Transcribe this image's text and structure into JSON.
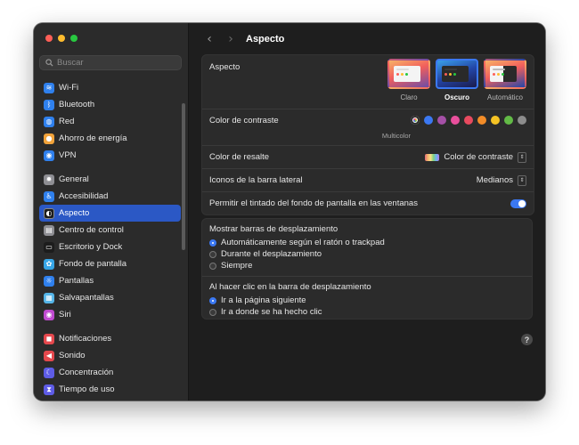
{
  "window": {
    "title": "Aspecto"
  },
  "sidebar": {
    "search_placeholder": "Buscar",
    "groups": [
      [
        {
          "label": "Wi-Fi",
          "icon": "wifi-icon",
          "color": "#2f80ed"
        },
        {
          "label": "Bluetooth",
          "icon": "bluetooth-icon",
          "color": "#2f80ed"
        },
        {
          "label": "Red",
          "icon": "globe-icon",
          "color": "#2f80ed"
        },
        {
          "label": "Ahorro de energía",
          "icon": "lightbulb-icon",
          "color": "#f2a33b"
        },
        {
          "label": "VPN",
          "icon": "vpn-icon",
          "color": "#2f80ed"
        }
      ],
      [
        {
          "label": "General",
          "icon": "gear-icon",
          "color": "#8e8e93"
        },
        {
          "label": "Accesibilidad",
          "icon": "accessibility-icon",
          "color": "#2f80ed"
        },
        {
          "label": "Aspecto",
          "icon": "appearance-icon",
          "color": "#1c1c1c",
          "active": true
        },
        {
          "label": "Centro de control",
          "icon": "control-center-icon",
          "color": "#8e8e93"
        },
        {
          "label": "Escritorio y Dock",
          "icon": "dock-icon",
          "color": "#1c1c1c"
        },
        {
          "label": "Fondo de pantalla",
          "icon": "wallpaper-icon",
          "color": "#37a6e6"
        },
        {
          "label": "Pantallas",
          "icon": "display-icon",
          "color": "#2f80ed"
        },
        {
          "label": "Salvapantallas",
          "icon": "screensaver-icon",
          "color": "#55b5e8"
        },
        {
          "label": "Siri",
          "icon": "siri-icon",
          "color": "#c04ad0"
        }
      ],
      [
        {
          "label": "Notificaciones",
          "icon": "bell-icon",
          "color": "#e5484d"
        },
        {
          "label": "Sonido",
          "icon": "speaker-icon",
          "color": "#e5484d"
        },
        {
          "label": "Concentración",
          "icon": "moon-icon",
          "color": "#5e5ce6"
        },
        {
          "label": "Tiempo de uso",
          "icon": "hourglass-icon",
          "color": "#5e5ce6"
        }
      ]
    ]
  },
  "appearance": {
    "label": "Aspecto",
    "options": [
      {
        "label": "Claro",
        "selected": false
      },
      {
        "label": "Oscuro",
        "selected": true
      },
      {
        "label": "Automático",
        "selected": false
      }
    ]
  },
  "contrast": {
    "label": "Color de contraste",
    "colors": [
      "multicolor",
      "#3b78f2",
      "#a550a7",
      "#e94f9c",
      "#e84a5f",
      "#f28c28",
      "#f5c324",
      "#62ba46",
      "#8c8c8c"
    ],
    "selected_caption": "Multicolor"
  },
  "highlight": {
    "label": "Color de resalte",
    "value": "Color de contraste"
  },
  "sidebar_icons": {
    "label": "Iconos de la barra lateral",
    "value": "Medianos"
  },
  "tinting": {
    "label": "Permitir el tintado del fondo de pantalla en las ventanas",
    "enabled": true
  },
  "scrollbars": {
    "title": "Mostrar barras de desplazamiento",
    "options": [
      {
        "label": "Automáticamente según el ratón o trackpad",
        "selected": true
      },
      {
        "label": "Durante el desplazamiento",
        "selected": false
      },
      {
        "label": "Siempre",
        "selected": false
      }
    ]
  },
  "click_scroll": {
    "title": "Al hacer clic en la barra de desplazamiento",
    "options": [
      {
        "label": "Ir a la página siguiente",
        "selected": true
      },
      {
        "label": "Ir a donde se ha hecho clic",
        "selected": false
      }
    ]
  },
  "help": {
    "label": "?"
  }
}
